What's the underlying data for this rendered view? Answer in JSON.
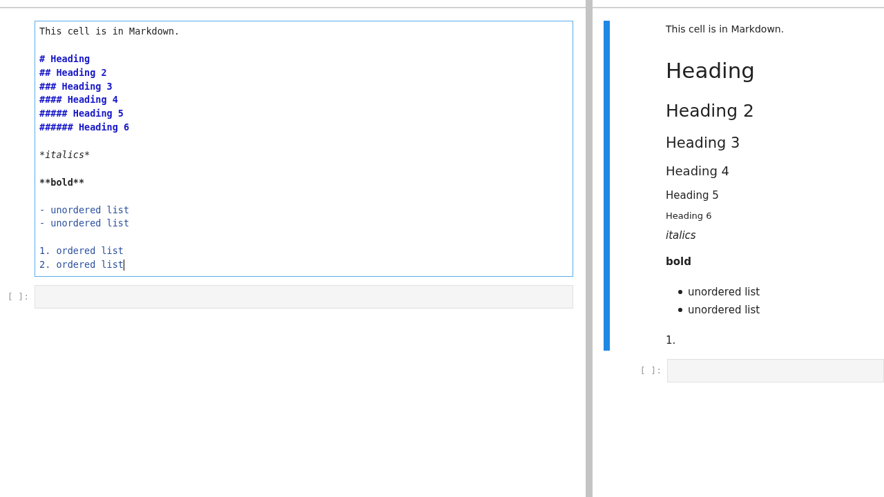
{
  "left_notebook": {
    "editor_cell": {
      "lines": [
        {
          "kind": "text",
          "text": "This cell is in Markdown."
        },
        {
          "kind": "blank"
        },
        {
          "kind": "heading",
          "text": "# Heading"
        },
        {
          "kind": "heading",
          "text": "## Heading 2"
        },
        {
          "kind": "heading",
          "text": "### Heading 3"
        },
        {
          "kind": "heading",
          "text": "#### Heading 4"
        },
        {
          "kind": "heading",
          "text": "##### Heading 5"
        },
        {
          "kind": "heading",
          "text": "###### Heading 6"
        },
        {
          "kind": "blank"
        },
        {
          "kind": "italic",
          "text": "*italics*"
        },
        {
          "kind": "blank"
        },
        {
          "kind": "bold",
          "text": "**bold**"
        },
        {
          "kind": "blank"
        },
        {
          "kind": "list",
          "text": "- unordered list"
        },
        {
          "kind": "list",
          "text": "- unordered list"
        },
        {
          "kind": "blank"
        },
        {
          "kind": "list",
          "text": "1. ordered list"
        },
        {
          "kind": "list",
          "text": "2. ordered list"
        }
      ]
    },
    "empty_cell": {
      "prompt": "[ ]:"
    }
  },
  "right_notebook": {
    "rendered_cell": {
      "blocks": [
        {
          "kind": "p",
          "text": "This cell is in Markdown."
        },
        {
          "kind": "h1",
          "text": "Heading"
        },
        {
          "kind": "h2",
          "text": "Heading 2"
        },
        {
          "kind": "h3",
          "text": "Heading 3"
        },
        {
          "kind": "h4",
          "text": "Heading 4"
        },
        {
          "kind": "h5",
          "text": "Heading 5"
        },
        {
          "kind": "h6",
          "text": "Heading 6"
        },
        {
          "kind": "em",
          "text": "italics"
        },
        {
          "kind": "strong",
          "text": "bold"
        },
        {
          "kind": "ul",
          "items": [
            "unordered list",
            "unordered list"
          ]
        },
        {
          "kind": "ol",
          "items": [
            "1."
          ]
        }
      ]
    },
    "empty_cell": {
      "prompt": "[ ]:"
    }
  }
}
